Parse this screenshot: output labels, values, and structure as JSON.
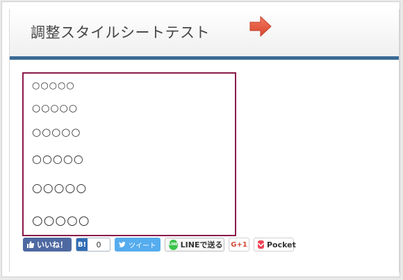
{
  "page": {
    "title": "調整スタイルシートテスト"
  },
  "content": {
    "lines": [
      "○○○○○",
      "○○○○○",
      "○○○○○",
      "○○○○○",
      "○○○○○",
      "○○○○○"
    ]
  },
  "share": {
    "facebook_label": "いいね！",
    "hatena_label": "B!",
    "hatena_count": "0",
    "twitter_label": "ツイート",
    "line_icon_text": "LINE",
    "line_label": "LINEで送る",
    "gplus_label": "G+1",
    "pocket_label": "Pocket"
  },
  "colors": {
    "header_bar": "#3b6a95",
    "content_border": "#8a1a4a",
    "arrow": "#e8563f",
    "facebook": "#4e69a2",
    "twitter": "#55acee",
    "line": "#3ac44a",
    "pocket": "#ee4256"
  }
}
